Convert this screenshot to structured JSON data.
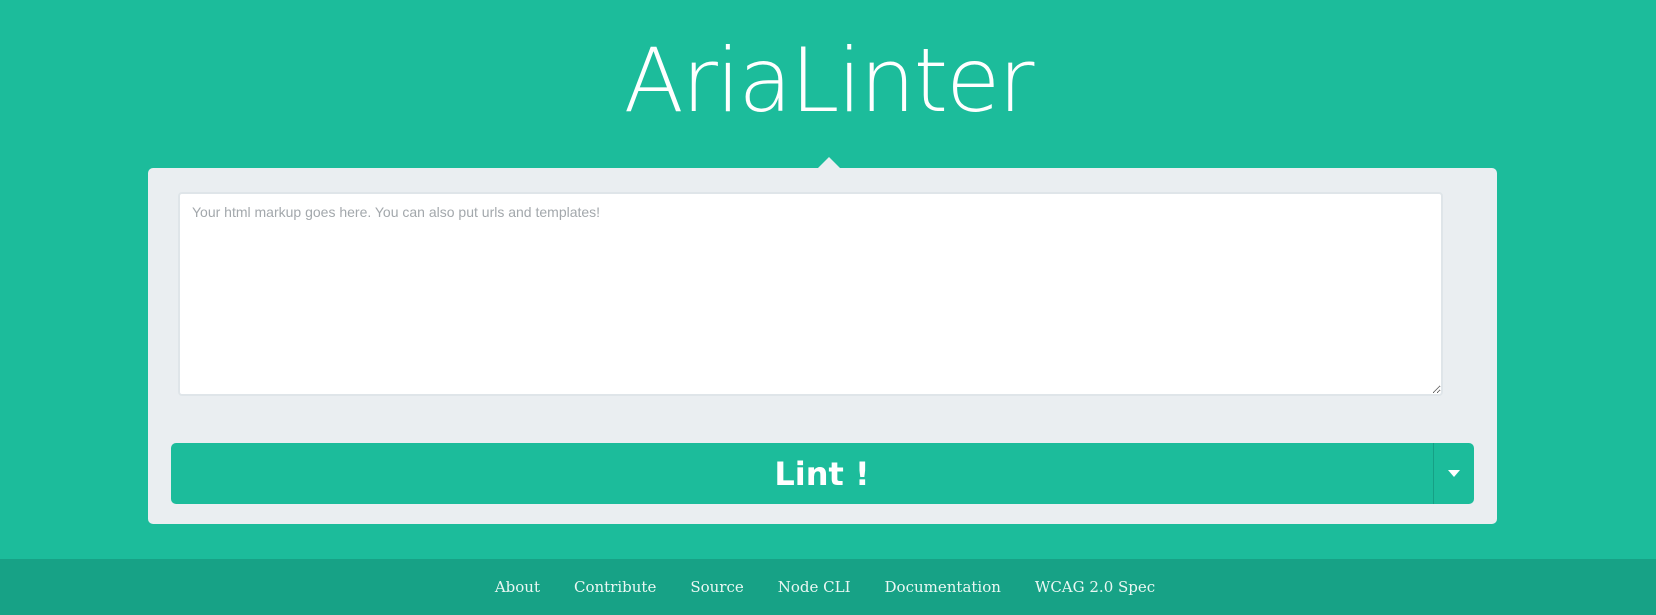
{
  "header": {
    "logo_text": "AriaLinter"
  },
  "editor": {
    "placeholder": "Your html markup goes here. You can also put urls and templates!",
    "value": ""
  },
  "actions": {
    "lint_label": "Lint !",
    "toggle_icon": "caret-down-icon"
  },
  "footer": {
    "links": [
      {
        "label": "About"
      },
      {
        "label": "Contribute"
      },
      {
        "label": "Source"
      },
      {
        "label": "Node CLI"
      },
      {
        "label": "Documentation"
      },
      {
        "label": "WCAG 2.0 Spec"
      }
    ]
  },
  "colors": {
    "background": "#1cbc9b",
    "panel": "#eaeef1",
    "footer": "#17a286",
    "button": "#1cbc9b",
    "text_light": "#ffffff"
  }
}
